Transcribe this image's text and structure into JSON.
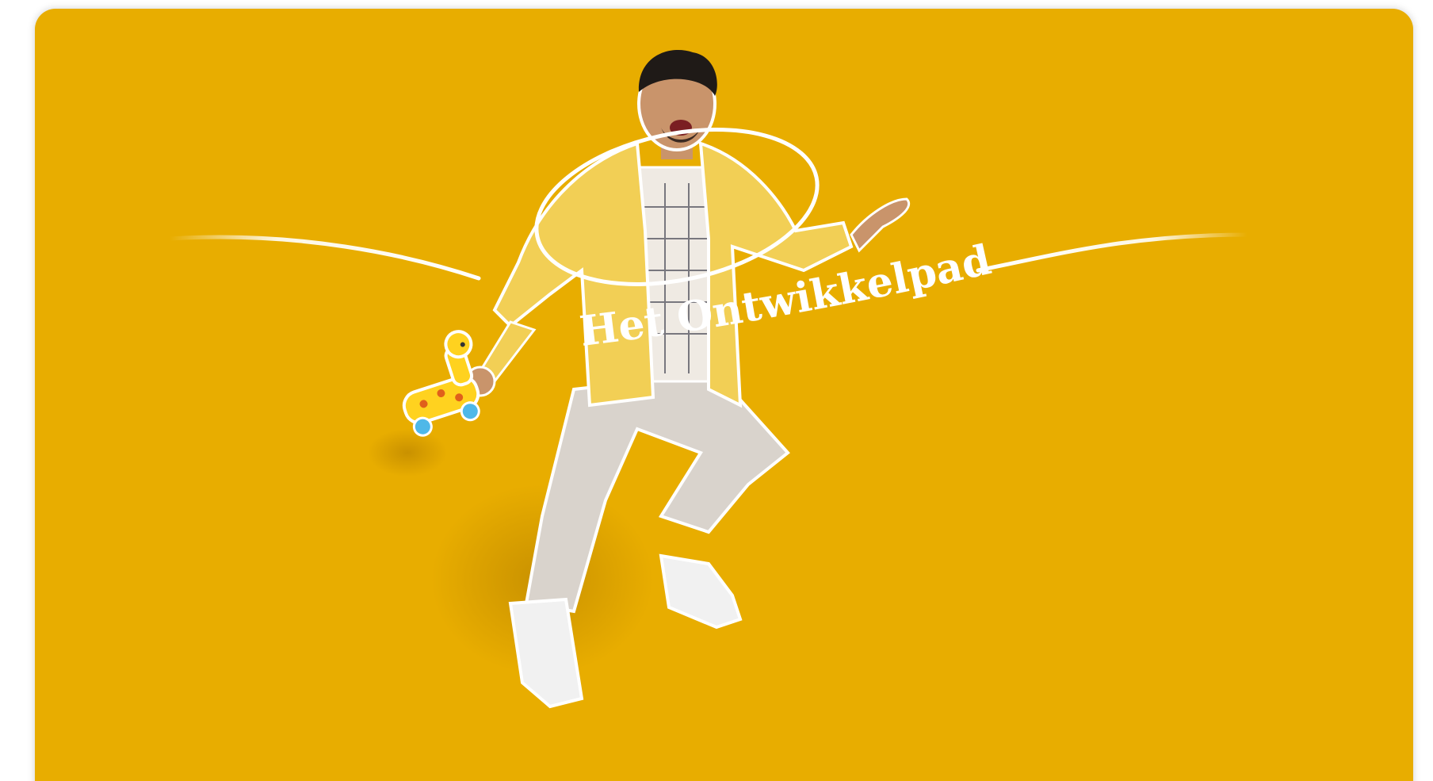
{
  "hero": {
    "title": "Het Ontwikkelpad",
    "background_color": "#e8ad00",
    "illustration": "person-jumping-with-toy-giraffe",
    "toy_icon": "toy-giraffe-icon"
  }
}
